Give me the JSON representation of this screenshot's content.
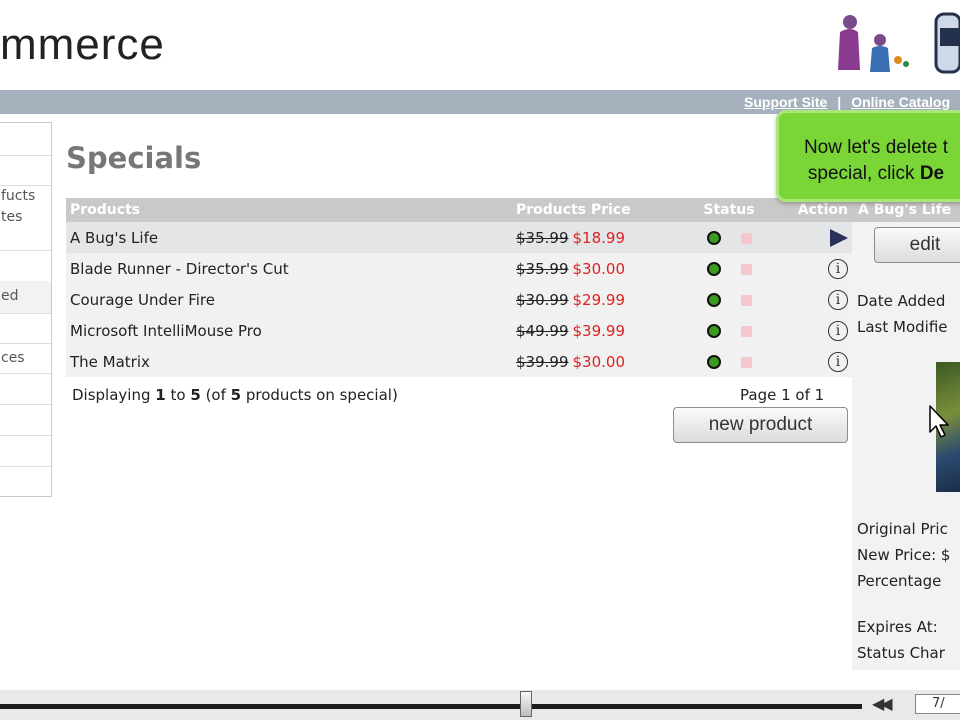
{
  "header": {
    "logo_text": "mmerce"
  },
  "topbar": {
    "links": [
      "Support Site",
      "Online Catalog"
    ],
    "separator": "|"
  },
  "sidebar": {
    "items": [
      "",
      "",
      "fucts",
      "tes",
      "",
      "ed",
      "",
      "ces",
      "",
      "",
      ""
    ]
  },
  "page": {
    "title": "Specials"
  },
  "table": {
    "headers": {
      "products": "Products",
      "price": "Products Price",
      "status": "Status",
      "action": "Action"
    },
    "rows": [
      {
        "product": "A Bug's Life",
        "old_price": "$35.99",
        "new_price": "$18.99"
      },
      {
        "product": "Blade Runner - Director's Cut",
        "old_price": "$35.99",
        "new_price": "$30.00"
      },
      {
        "product": "Courage Under Fire",
        "old_price": "$30.99",
        "new_price": "$29.99"
      },
      {
        "product": "Microsoft IntelliMouse Pro",
        "old_price": "$49.99",
        "new_price": "$39.99"
      },
      {
        "product": "The Matrix",
        "old_price": "$39.99",
        "new_price": "$30.00"
      }
    ]
  },
  "footer": {
    "displaying_prefix": "Displaying",
    "from": "1",
    "to_word": "to",
    "to": "5",
    "of_prefix": "(of",
    "total": "5",
    "of_suffix": "products on special)",
    "page_text": "Page 1 of 1"
  },
  "buttons": {
    "new_product": "new product",
    "edit": "edit"
  },
  "right_panel": {
    "heading": "A Bug's Life",
    "date_added": "Date Added",
    "last_modified": "Last Modifie",
    "original_price": "Original Pric",
    "new_price": "New Price: $",
    "percentage": "Percentage",
    "expires_at": "Expires At:",
    "status_change": "Status Char"
  },
  "callout": {
    "line1": "Now let's delete t",
    "line2_prefix": "special, click",
    "line2_bold": "De"
  },
  "player": {
    "time": "7/",
    "rewind_symbol": "◀◀"
  },
  "colors": {
    "topbar": "#a7b1bd",
    "header_cell": "#c9c9c9",
    "new_price": "#d22222",
    "status_green": "#3b9a1f",
    "callout": "#7ad636"
  }
}
